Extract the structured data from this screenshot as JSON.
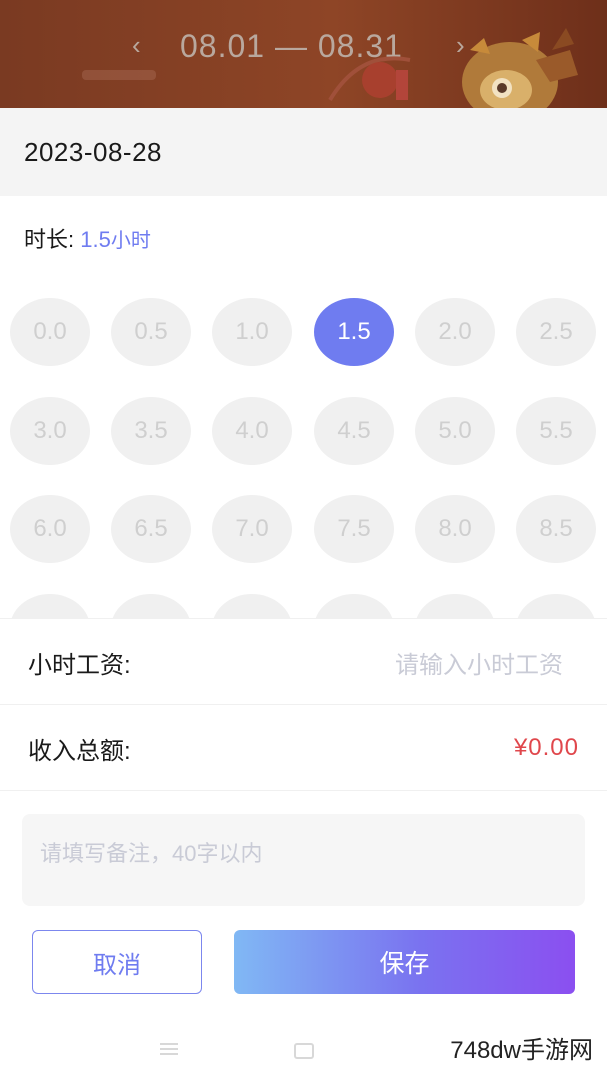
{
  "header": {
    "prev_arrow": "‹",
    "next_arrow": "›",
    "date_range": "08.01 — 08.31"
  },
  "date": "2023-08-28",
  "duration": {
    "label": "时长:",
    "value": "1.5",
    "unit": "小时"
  },
  "hour_options": [
    "0.0",
    "0.5",
    "1.0",
    "1.5",
    "2.0",
    "2.5",
    "3.0",
    "3.5",
    "4.0",
    "4.5",
    "5.0",
    "5.5",
    "6.0",
    "6.5",
    "7.0",
    "7.5",
    "8.0",
    "8.5"
  ],
  "selected_hour": "1.5",
  "hourly_wage": {
    "label": "小时工资:",
    "placeholder": "请输入小时工资"
  },
  "total_income": {
    "label": "收入总额:",
    "value": "¥0.00"
  },
  "note": {
    "placeholder": "请填写备注，40字以内"
  },
  "buttons": {
    "cancel": "取消",
    "save": "保存"
  },
  "watermark": "748dw手游网",
  "colors": {
    "accent": "#6f7cf0",
    "amount": "#e0474c",
    "header_bg": "#7a3a22"
  }
}
